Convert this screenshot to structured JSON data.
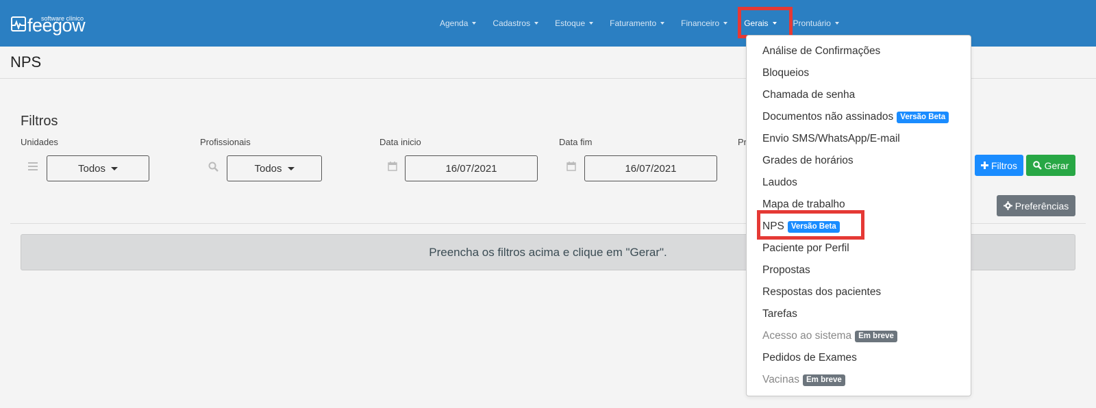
{
  "logo": {
    "subtitle": "software clínico",
    "name": "feegow"
  },
  "nav": {
    "items": [
      {
        "label": "Agenda"
      },
      {
        "label": "Cadastros"
      },
      {
        "label": "Estoque"
      },
      {
        "label": "Faturamento"
      },
      {
        "label": "Financeiro"
      },
      {
        "label": "Gerais"
      },
      {
        "label": "Prontuário"
      }
    ]
  },
  "page": {
    "title": "NPS"
  },
  "filters": {
    "title": "Filtros",
    "unidades": {
      "label": "Unidades",
      "value": "Todos"
    },
    "profissionais": {
      "label": "Profissionais",
      "value": "Todos"
    },
    "data_inicio": {
      "label": "Data inicio",
      "value": "16/07/2021"
    },
    "data_fim": {
      "label": "Data fim",
      "value": "16/07/2021"
    },
    "partial_label": "Pr"
  },
  "buttons": {
    "filtros": "Filtros",
    "gerar": "Gerar",
    "preferencias": "Preferências"
  },
  "info_message": "Preencha os filtros acima e clique em \"Gerar\".",
  "dropdown": {
    "items": [
      {
        "label": "Análise de Confirmações"
      },
      {
        "label": "Bloqueios"
      },
      {
        "label": "Chamada de senha"
      },
      {
        "label": "Documentos não assinados",
        "badge": "Versão Beta"
      },
      {
        "label": "Envio SMS/WhatsApp/E-mail"
      },
      {
        "label": "Grades de horários"
      },
      {
        "label": "Laudos"
      },
      {
        "label": "Mapa de trabalho"
      },
      {
        "label": "NPS",
        "badge": "Versão Beta"
      },
      {
        "label": "Paciente por Perfil"
      },
      {
        "label": "Propostas"
      },
      {
        "label": "Respostas dos pacientes"
      },
      {
        "label": "Tarefas"
      },
      {
        "label": "Acesso ao sistema",
        "badge": "Em breve"
      },
      {
        "label": "Pedidos de Exames"
      },
      {
        "label": "Vacinas",
        "badge": "Em breve"
      }
    ]
  },
  "colors": {
    "navbar": "#2b7fc2",
    "highlight": "#e53935",
    "beta_badge": "#1a8cff",
    "soon_badge": "#6c757d",
    "gerar": "#28a745"
  }
}
